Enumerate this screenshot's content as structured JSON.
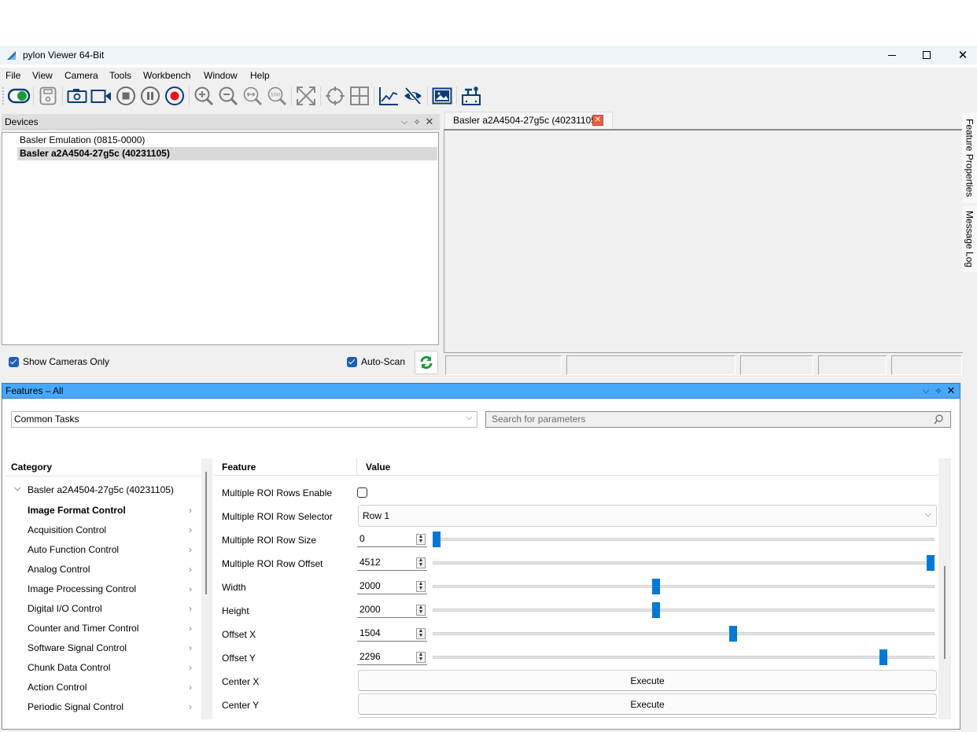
{
  "window": {
    "title": "pylon Viewer 64-Bit",
    "controls": {
      "minimize": "—",
      "maximize": "☐",
      "close": "✕"
    }
  },
  "menu": [
    "File",
    "View",
    "Camera",
    "Tools",
    "Workbench",
    "Window",
    "Help"
  ],
  "toolbar": {
    "icons": [
      "toggle-open-camera-icon",
      "save-icon",
      "single-shot-icon",
      "continuous-shot-icon",
      "stop-icon",
      "pause-icon",
      "record-icon",
      "zoom-in-icon",
      "zoom-out-icon",
      "zoom-fit-icon",
      "zoom-100-icon",
      "fullscreen-icon",
      "crosshair-icon",
      "grid-icon",
      "chart-icon",
      "hide-icon",
      "image-icon",
      "tools-icon"
    ]
  },
  "devices": {
    "title": "Devices",
    "items": [
      {
        "label": "Basler Emulation (0815-0000)",
        "selected": false
      },
      {
        "label": "Basler a2A4504-27g5c (40231105)",
        "selected": true
      }
    ],
    "show_cameras_only": {
      "label": "Show Cameras Only",
      "checked": true
    },
    "auto_scan": {
      "label": "Auto-Scan",
      "checked": true
    }
  },
  "viewer": {
    "tab_label": "Basler a2A4504-27g5c (40231105)"
  },
  "side_tabs": [
    "Feature Properties",
    "Message Log"
  ],
  "features": {
    "title": "Features – All",
    "view_select": "Common Tasks",
    "search_placeholder": "Search for parameters",
    "category_header": "Category",
    "feature_header": "Feature",
    "value_header": "Value",
    "device_node": "Basler a2A4504-27g5c (40231105)",
    "categories": [
      {
        "label": "Image Format Control",
        "bold": true
      },
      {
        "label": "Acquisition Control"
      },
      {
        "label": "Auto Function Control"
      },
      {
        "label": "Analog Control"
      },
      {
        "label": "Image Processing Control"
      },
      {
        "label": "Digital I/O Control"
      },
      {
        "label": "Counter and Timer Control"
      },
      {
        "label": "Software Signal Control"
      },
      {
        "label": "Chunk Data Control"
      },
      {
        "label": "Action Control"
      },
      {
        "label": "Periodic Signal Control"
      }
    ],
    "rows": [
      {
        "label": "Multiple ROI Rows Enable",
        "type": "checkbox",
        "checked": false
      },
      {
        "label": "Multiple ROI Row Selector",
        "type": "select",
        "value": "Row 1"
      },
      {
        "label": "Multiple ROI Row Size",
        "type": "slider",
        "value": "0",
        "fraction": 0.0
      },
      {
        "label": "Multiple ROI Row Offset",
        "type": "slider",
        "value": "4512",
        "fraction": 1.0
      },
      {
        "label": "Width",
        "type": "slider",
        "value": "2000",
        "fraction": 0.445
      },
      {
        "label": "Height",
        "type": "slider",
        "value": "2000",
        "fraction": 0.445
      },
      {
        "label": "Offset X",
        "type": "slider",
        "value": "1504",
        "fraction": 0.6
      },
      {
        "label": "Offset Y",
        "type": "slider",
        "value": "2296",
        "fraction": 0.905
      },
      {
        "label": "Center X",
        "type": "button",
        "value": "Execute"
      },
      {
        "label": "Center Y",
        "type": "button",
        "value": "Execute"
      }
    ]
  }
}
